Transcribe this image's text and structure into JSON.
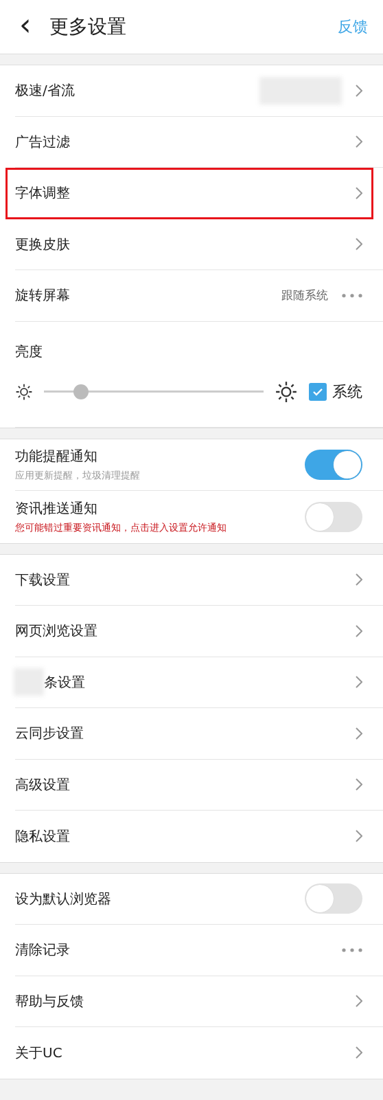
{
  "header": {
    "back": "‹",
    "title": "更多设置",
    "action": "反馈"
  },
  "sections": [
    {
      "rows": [
        {
          "kind": "chevron",
          "label": "极速/省流",
          "redacted": true,
          "highlighted": false
        },
        {
          "kind": "chevron",
          "label": "广告过滤",
          "highlighted": false
        },
        {
          "kind": "chevron",
          "label": "字体调整",
          "highlighted": true
        },
        {
          "kind": "chevron",
          "label": "更换皮肤",
          "highlighted": false
        },
        {
          "kind": "more",
          "label": "旋转屏幕",
          "value": "跟随系统",
          "highlighted": false
        },
        {
          "kind": "brightness",
          "label": "亮度",
          "level": 0.17,
          "checked": true,
          "check_label": "系统"
        }
      ]
    },
    {
      "rows": [
        {
          "kind": "toggle",
          "label": "功能提醒通知",
          "note": "应用更新提醒，垃圾清理提醒",
          "warning": false,
          "on": true
        },
        {
          "kind": "toggle",
          "label": "资讯推送通知",
          "note": "您可能错过重要资讯通知，点击进入设置允许通知",
          "warning": true,
          "on": false
        }
      ]
    },
    {
      "rows": [
        {
          "kind": "chevron",
          "label": "下载设置",
          "highlighted": false
        },
        {
          "kind": "chevron",
          "label": "网页浏览设置",
          "highlighted": false
        },
        {
          "kind": "chevron",
          "label": "条设置",
          "redacted": true,
          "highlighted": false
        },
        {
          "kind": "chevron",
          "label": "云同步设置",
          "highlighted": false
        },
        {
          "kind": "chevron",
          "label": "高级设置",
          "highlighted": false
        },
        {
          "kind": "chevron",
          "label": "隐私设置",
          "highlighted": false
        }
      ]
    },
    {
      "rows": [
        {
          "kind": "toggle",
          "label": "设为默认浏览器",
          "on": false
        },
        {
          "kind": "more",
          "label": "清除记录",
          "highlighted": false
        },
        {
          "kind": "chevron",
          "label": "帮助与反馈",
          "highlighted": false
        },
        {
          "kind": "chevron",
          "label": "关于UC",
          "highlighted": false
        }
      ]
    }
  ]
}
